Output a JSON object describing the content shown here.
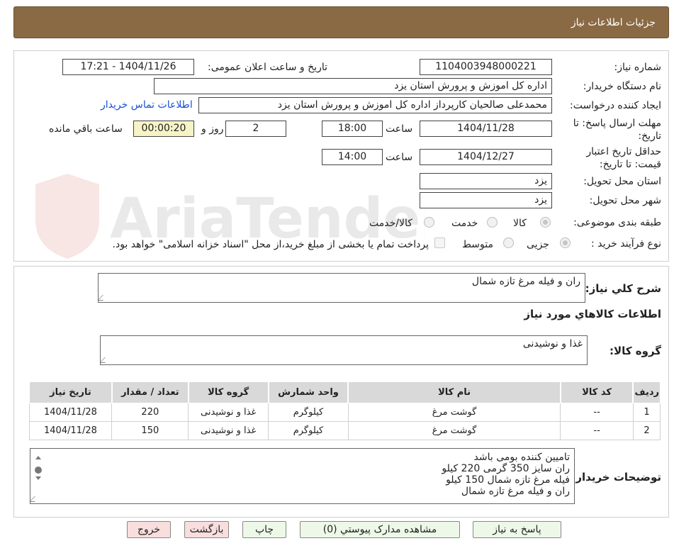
{
  "header": {
    "title": "جزئیات اطلاعات نیاز"
  },
  "watermark": {
    "text": "AriaTender.neT"
  },
  "form": {
    "need_number": {
      "label": "شماره نیاز:",
      "value": "1104003948000221"
    },
    "announce": {
      "label": "تاریخ و ساعت اعلان عمومی:",
      "value": "1404/11/26 - 17:21"
    },
    "buyer_org": {
      "label": "نام دستگاه خریدار:",
      "value": "اداره کل اموزش و پرورش استان یزد"
    },
    "requester": {
      "label": "ایجاد کننده درخواست:",
      "value": "محمدعلی صالحیان کارپرداز اداره کل اموزش و پرورش استان یزد",
      "contact_link": "اطلاعات تماس خریدار"
    },
    "deadline": {
      "label_line1": "مهلت ارسال پاسخ: تا",
      "label_line2": "تاریخ:",
      "date": "1404/11/28",
      "time_label": "ساعت",
      "time": "18:00",
      "days": "2",
      "days_label": "روز و",
      "timer": "00:00:20",
      "remaining_label": "ساعت باقي مانده"
    },
    "validity": {
      "label_line1": "حداقل تاریخ اعتبار",
      "label_line2": "قیمت: تا تاریخ:",
      "date": "1404/12/27",
      "time_label": "ساعت",
      "time": "14:00"
    },
    "province": {
      "label": "استان محل تحویل:",
      "value": "یزد"
    },
    "city": {
      "label": "شهر محل تحویل:",
      "value": "یزد"
    },
    "category": {
      "label": "طبقه بندی موضوعی:",
      "options": [
        "کالا",
        "خدمت",
        "کالا/خدمت"
      ],
      "selected": "کالا"
    },
    "process": {
      "label": "نوع فرآیند خرید :",
      "options": [
        "جزیی",
        "متوسط"
      ],
      "selected": "جزیی",
      "note": "پرداخت تمام یا بخشی از مبلغ خرید،از محل \"اسناد خزانه اسلامی\" خواهد بود."
    }
  },
  "summary": {
    "label": "شرح کلي نياز:",
    "value": "ران و فیله مرغ تازه شمال",
    "items_heading": "اطلاعات کالاهاي مورد نياز",
    "group_label": "گروه کالا:",
    "group_value": "غذا و نوشیدنی"
  },
  "table": {
    "columns": [
      "رديف",
      "کد کالا",
      "نام کالا",
      "واحد شمارش",
      "گروه کالا",
      "تعداد / مقدار",
      "تاریخ نیاز"
    ],
    "rows": [
      [
        "1",
        "--",
        "گوشت مرغ",
        "کیلوگرم",
        "غذا و نوشیدنی",
        "220",
        "1404/11/28"
      ],
      [
        "2",
        "--",
        "گوشت مرغ",
        "کیلوگرم",
        "غذا و نوشیدنی",
        "150",
        "1404/11/28"
      ]
    ]
  },
  "buyer_notes": {
    "label": "توضیحات خریدار:",
    "lines": [
      "تامیین کننده بومی باشد",
      "ران سایز 350 گرمی 220 کیلو",
      "فیله مرغ تازه شمال 150 کیلو",
      "ران و فیله مرغ تازه شمال"
    ]
  },
  "buttons": {
    "reply": "پاسخ به نیاز",
    "attachments": "مشاهده مدارک پیوستي (0)",
    "print": "چاپ",
    "back": "بازگشت",
    "exit": "خروج"
  },
  "colors": {
    "header_bg": "#8a6a44",
    "link": "#1a4fd6",
    "timer_bg": "#f7f3c6",
    "table_header": "#d9d9d9"
  }
}
